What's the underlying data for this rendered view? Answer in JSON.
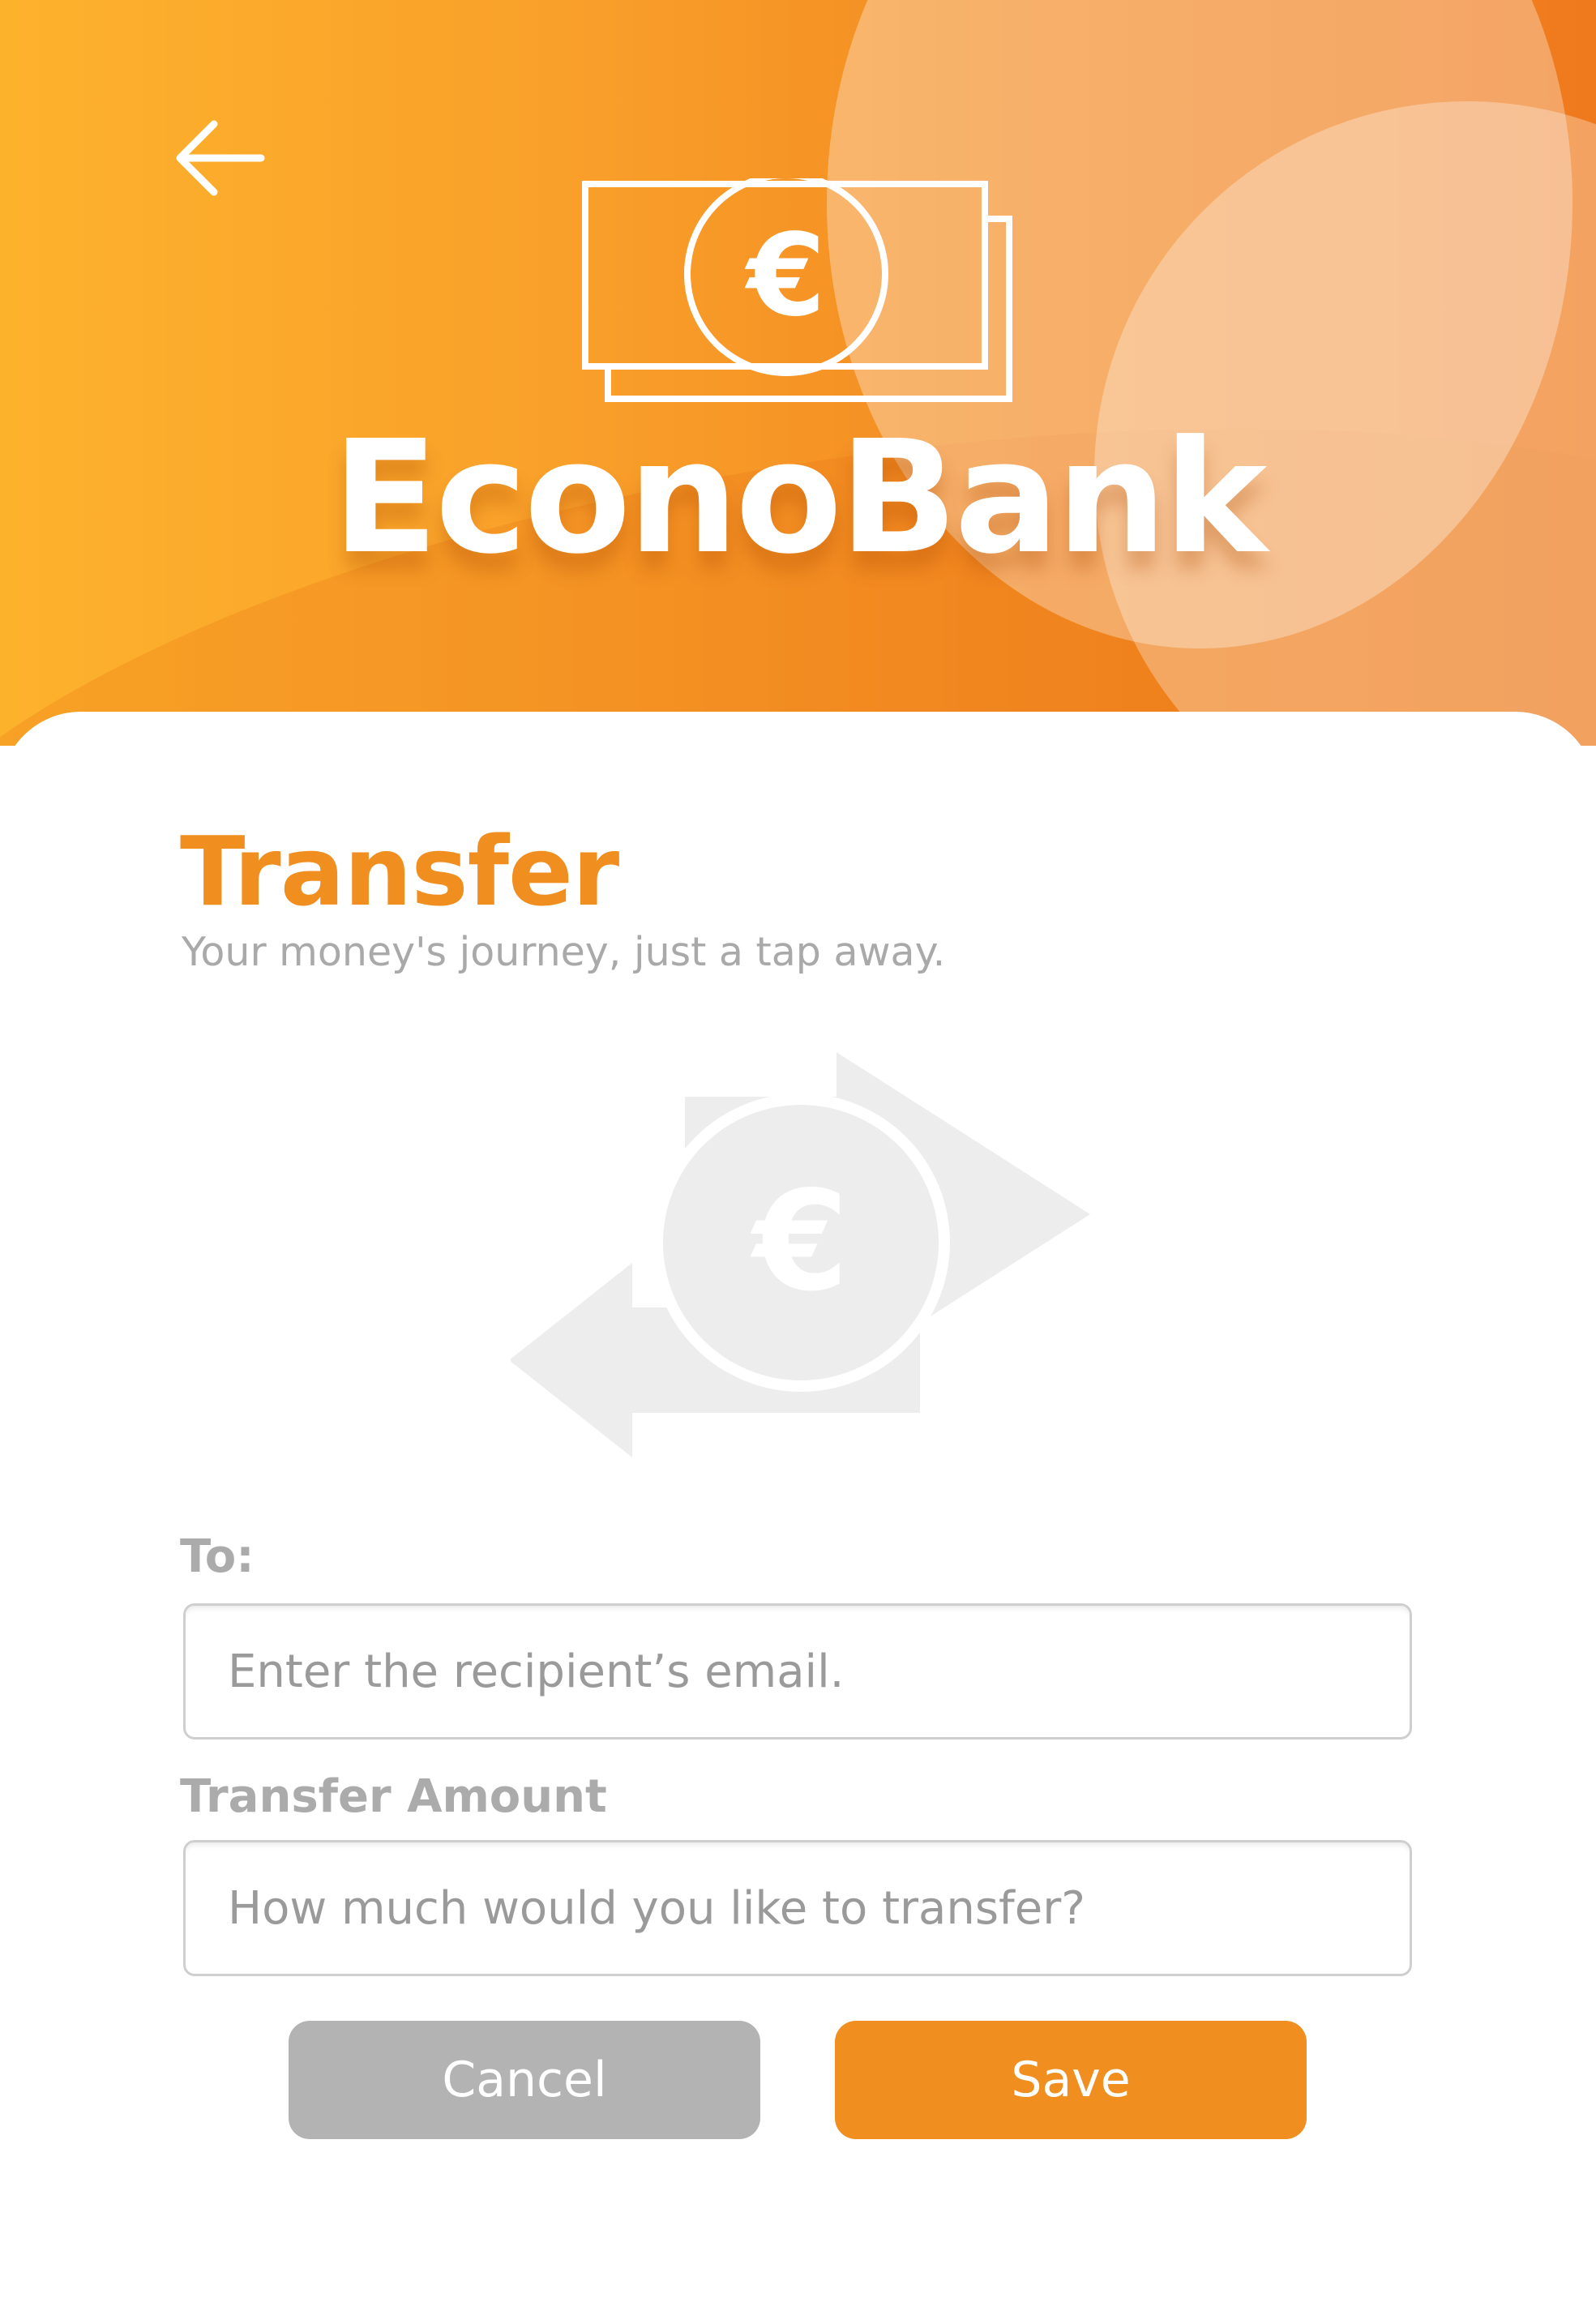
{
  "header": {
    "brand_name": "EconoBank",
    "logo_icon": "euro-banknote-icon",
    "back_icon": "arrow-left-icon"
  },
  "transfer": {
    "title": "Transfer",
    "subtitle": "Your money's journey, just a tap away.",
    "illustration_icon": "euro-transfer-arrows-icon"
  },
  "form": {
    "to_label": "To:",
    "to_placeholder": "Enter the recipient’s email.",
    "amount_label": "Transfer Amount",
    "amount_placeholder": "How much would you like to transfer?"
  },
  "actions": {
    "cancel_label": "Cancel",
    "save_label": "Save"
  },
  "colors": {
    "accent": "#f08e20",
    "header_gradient_start": "#fdb22c",
    "header_gradient_end": "#ef7a1e",
    "cancel_button": "#b3b3b3",
    "muted_text": "#a9a9a9",
    "illustration": "#ecedec"
  }
}
